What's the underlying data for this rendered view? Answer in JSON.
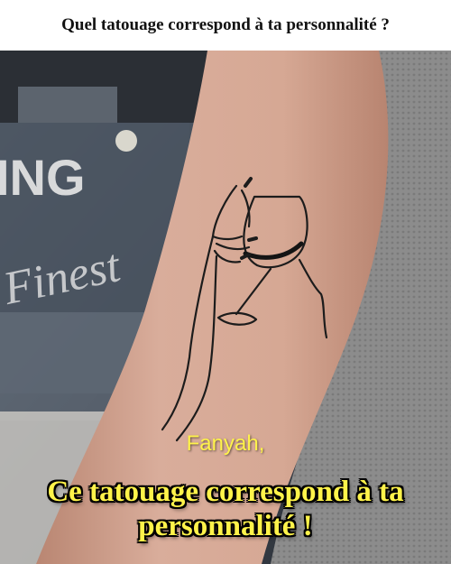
{
  "header": {
    "title": "Quel tatouage correspond à ta personnalité ?"
  },
  "photo": {
    "shop_sign_text": "ING",
    "shop_script_text": "Finest",
    "tattoo": "wine-glass-hand-line-tattoo"
  },
  "result": {
    "name": "Fanyah,",
    "message": "Ce tatouage correspond à ta personnalité !"
  },
  "colors": {
    "caption": "#fff34a",
    "skin": "#d4a694",
    "shirt": "#8a8a8a"
  }
}
